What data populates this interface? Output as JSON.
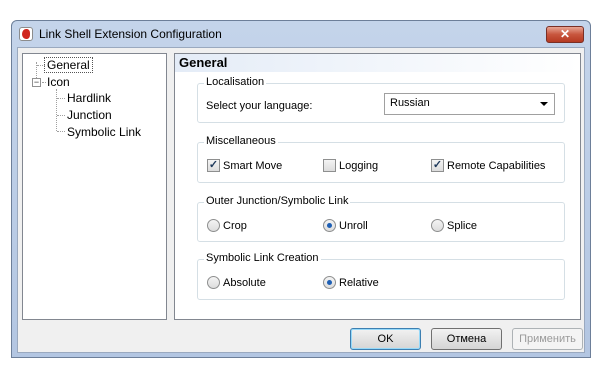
{
  "window": {
    "title": "Link Shell Extension Configuration",
    "close_glyph": "✕"
  },
  "tree": {
    "items": [
      "General",
      "Icon",
      "Hardlink",
      "Junction",
      "Symbolic Link"
    ],
    "expander_glyph": "−"
  },
  "panel": {
    "title": "General",
    "localisation": {
      "group_label": "Localisation",
      "language_label": "Select your language:",
      "language_value": "Russian"
    },
    "misc": {
      "group_label": "Miscellaneous",
      "options": [
        {
          "label": "Smart Move",
          "checked": true
        },
        {
          "label": "Logging",
          "checked": false
        },
        {
          "label": "Remote Capabilities",
          "checked": true
        }
      ]
    },
    "outer": {
      "group_label": "Outer Junction/Symbolic Link",
      "options": [
        {
          "label": "Crop",
          "selected": false
        },
        {
          "label": "Unroll",
          "selected": true
        },
        {
          "label": "Splice",
          "selected": false
        }
      ]
    },
    "symlink": {
      "group_label": "Symbolic Link Creation",
      "options": [
        {
          "label": "Absolute",
          "selected": false
        },
        {
          "label": "Relative",
          "selected": true
        }
      ]
    }
  },
  "buttons": {
    "ok": "OK",
    "cancel": "Отмена",
    "apply": "Применить"
  },
  "check_glyph": "✓"
}
